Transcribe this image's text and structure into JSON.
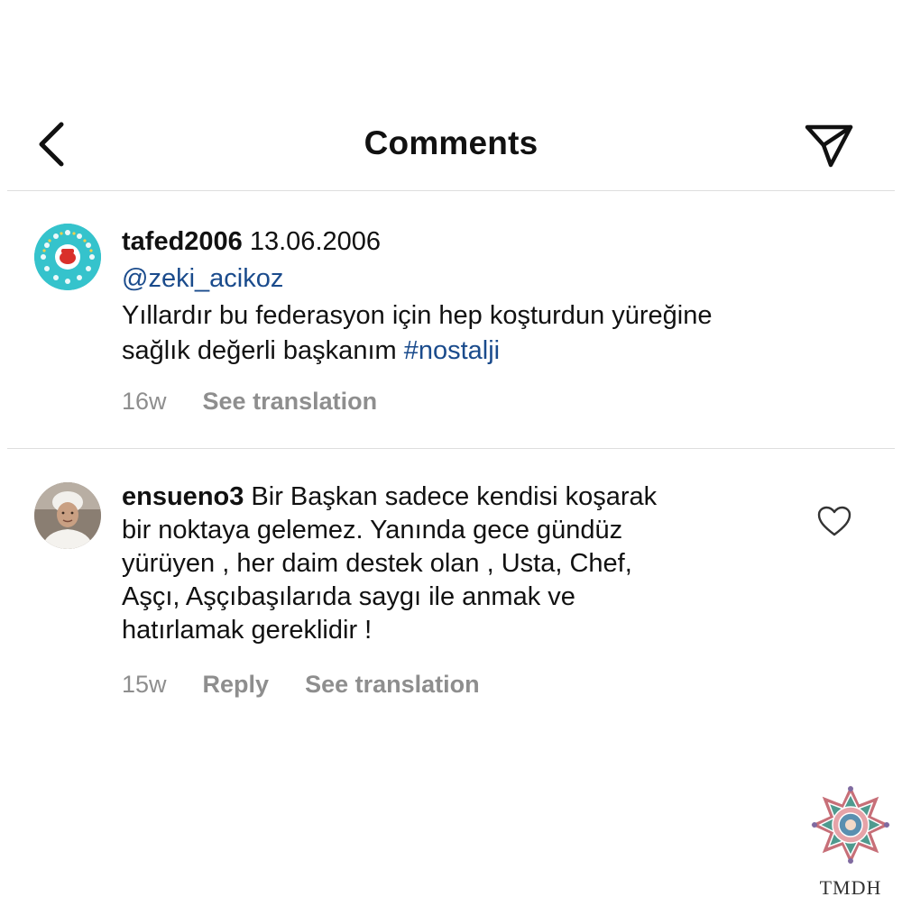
{
  "header": {
    "title": "Comments",
    "back_icon": "chevron-left-icon",
    "share_icon": "paper-plane-icon"
  },
  "comments": [
    {
      "username": "tafed2006",
      "after_username": " 13.06.2006",
      "mention": "@zeki_acikoz",
      "line1": "Yıllardır bu federasyon için hep koşturdun yüreğine",
      "line2_prefix": "sağlık değerli başkanım ",
      "hashtag": "#nostalji",
      "age": "16w",
      "translate": "See translation"
    },
    {
      "username": "ensueno3",
      "lines": [
        " Bir Başkan sadece kendisi koşarak",
        "bir noktaya gelemez. Yanında gece gündüz",
        "yürüyen , her daim destek olan , Usta, Chef,",
        "Aşçı, Aşçıbaşılarıda saygı ile anmak ve",
        "hatırlamak gereklidir !"
      ],
      "age": "15w",
      "reply": "Reply",
      "translate": "See translation"
    }
  ],
  "watermark": {
    "label": "TMDH"
  },
  "colors": {
    "link": "#1a4b8c",
    "meta": "#8e8e8e",
    "divider": "#dedede"
  }
}
